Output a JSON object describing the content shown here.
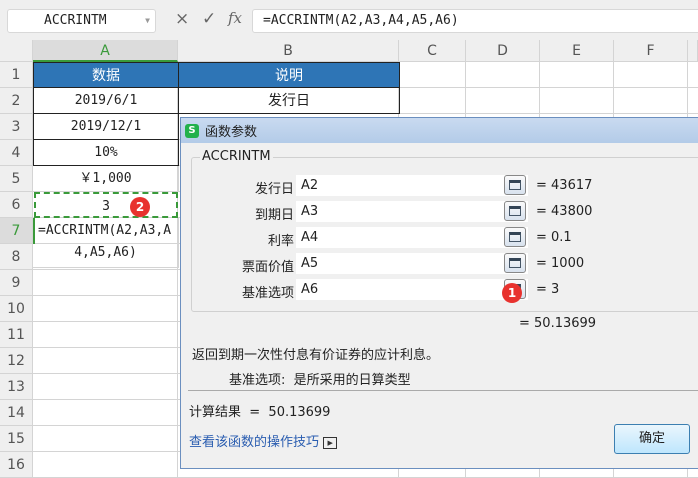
{
  "toolbar": {
    "name_box": "ACCRINTM",
    "cancel_icon": "×",
    "confirm_icon": "✓",
    "fx_label": "fx",
    "formula": "=ACCRINTM(A2,A3,A4,A5,A6)"
  },
  "columns": [
    "A",
    "B",
    "C",
    "D",
    "E",
    "F"
  ],
  "rows": [
    "1",
    "2",
    "3",
    "4",
    "5",
    "6",
    "7",
    "8",
    "9",
    "10",
    "11",
    "12",
    "13",
    "14",
    "15",
    "16"
  ],
  "cells": {
    "A1": "数据",
    "B1": "说明",
    "A2": "2019/6/1",
    "B2": "发行日",
    "A3": "2019/12/1",
    "A4": "10%",
    "A5": "￥1,000",
    "A6": "3",
    "A7": "=ACCRINTM(A2,A3,A",
    "A8": "4,A5,A6)"
  },
  "badges": {
    "one": "1",
    "two": "2"
  },
  "dialog": {
    "title": "函数参数",
    "function_name": "ACCRINTM",
    "args": [
      {
        "label": "发行日",
        "input": "A2",
        "value": "= 43617"
      },
      {
        "label": "到期日",
        "input": "A3",
        "value": "= 43800"
      },
      {
        "label": "利率",
        "input": "A4",
        "value": "= 0.1"
      },
      {
        "label": "票面价值",
        "input": "A5",
        "value": "= 1000"
      },
      {
        "label": "基准选项",
        "input": "A6",
        "value": "= 3"
      }
    ],
    "formula_result": "= 50.13699",
    "description": "返回到期一次性付息有价证券的应计利息。",
    "arg_help_label": "基准选项:",
    "arg_help_text": "是所采用的日算类型",
    "calc_result": "计算结果  =  50.13699",
    "help_link": "查看该函数的操作技巧",
    "ok_label": "确定"
  }
}
